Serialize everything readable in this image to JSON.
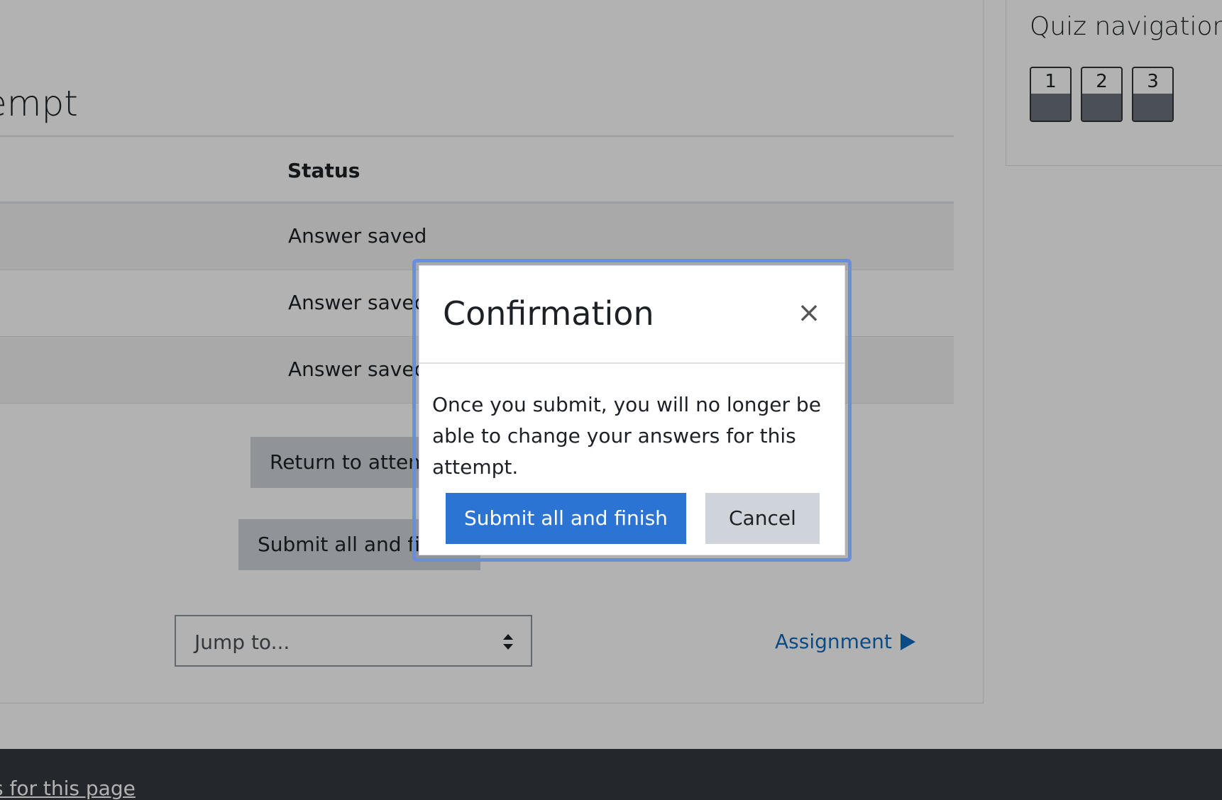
{
  "page": {
    "title": "empt",
    "table": {
      "status_header": "Status",
      "rows": [
        {
          "status": "Answer saved"
        },
        {
          "status": "Answer saved"
        },
        {
          "status": "Answer saved"
        }
      ]
    },
    "buttons": {
      "return_label": "Return to attempt",
      "submit_label": "Submit all and finish"
    },
    "jump_select": {
      "value": "Jump to...",
      "icon": "select-arrows-icon"
    },
    "next_link": {
      "label": "Assignment",
      "icon": "triangle-right-icon"
    }
  },
  "quiz_nav": {
    "title": "Quiz navigation",
    "questions": [
      "1",
      "2",
      "3"
    ]
  },
  "footer": {
    "link": "s for this page"
  },
  "modal": {
    "title": "Confirmation",
    "close_icon": "close-icon",
    "body": "Once you submit, you will no longer be able to change your answers for this attempt.",
    "submit_label": "Submit all and finish",
    "cancel_label": "Cancel"
  },
  "colors": {
    "primary": "#2b74d4",
    "link": "#0f6cbf",
    "focus_ring": "#6b8edc",
    "footer_bg": "#343a40",
    "secondary_btn": "#ced4da"
  }
}
